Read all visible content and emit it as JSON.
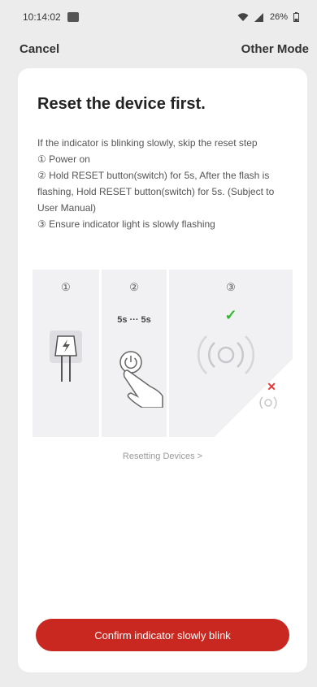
{
  "status_bar": {
    "time": "10:14:02",
    "battery": "26%"
  },
  "header": {
    "cancel_label": "Cancel",
    "other_mode_label": "Other Mode"
  },
  "content": {
    "title": "Reset the device first.",
    "intro": "If the indicator is blinking slowly, skip the reset step",
    "steps": [
      "① Power on",
      "② Hold RESET button(switch) for 5s, After the flash is flashing, Hold RESET button(switch) for 5s. (Subject to User Manual)",
      "③ Ensure indicator light is slowly flashing"
    ]
  },
  "illustration": {
    "panel_numbers": [
      "①",
      "②",
      "③"
    ],
    "timer_label": "5s ··· 5s",
    "icons": [
      "power-plug-icon",
      "power-button-icon",
      "hand-icon",
      "blinking-indicator-icon",
      "checkmark-icon",
      "cross-icon"
    ],
    "check_color": "#2eb82e",
    "cross_color": "#e53935"
  },
  "reset_link": "Resetting Devices >",
  "confirm_button": "Confirm indicator slowly blink",
  "colors": {
    "accent": "#c8281f",
    "background": "#ececec",
    "card": "#ffffff"
  }
}
